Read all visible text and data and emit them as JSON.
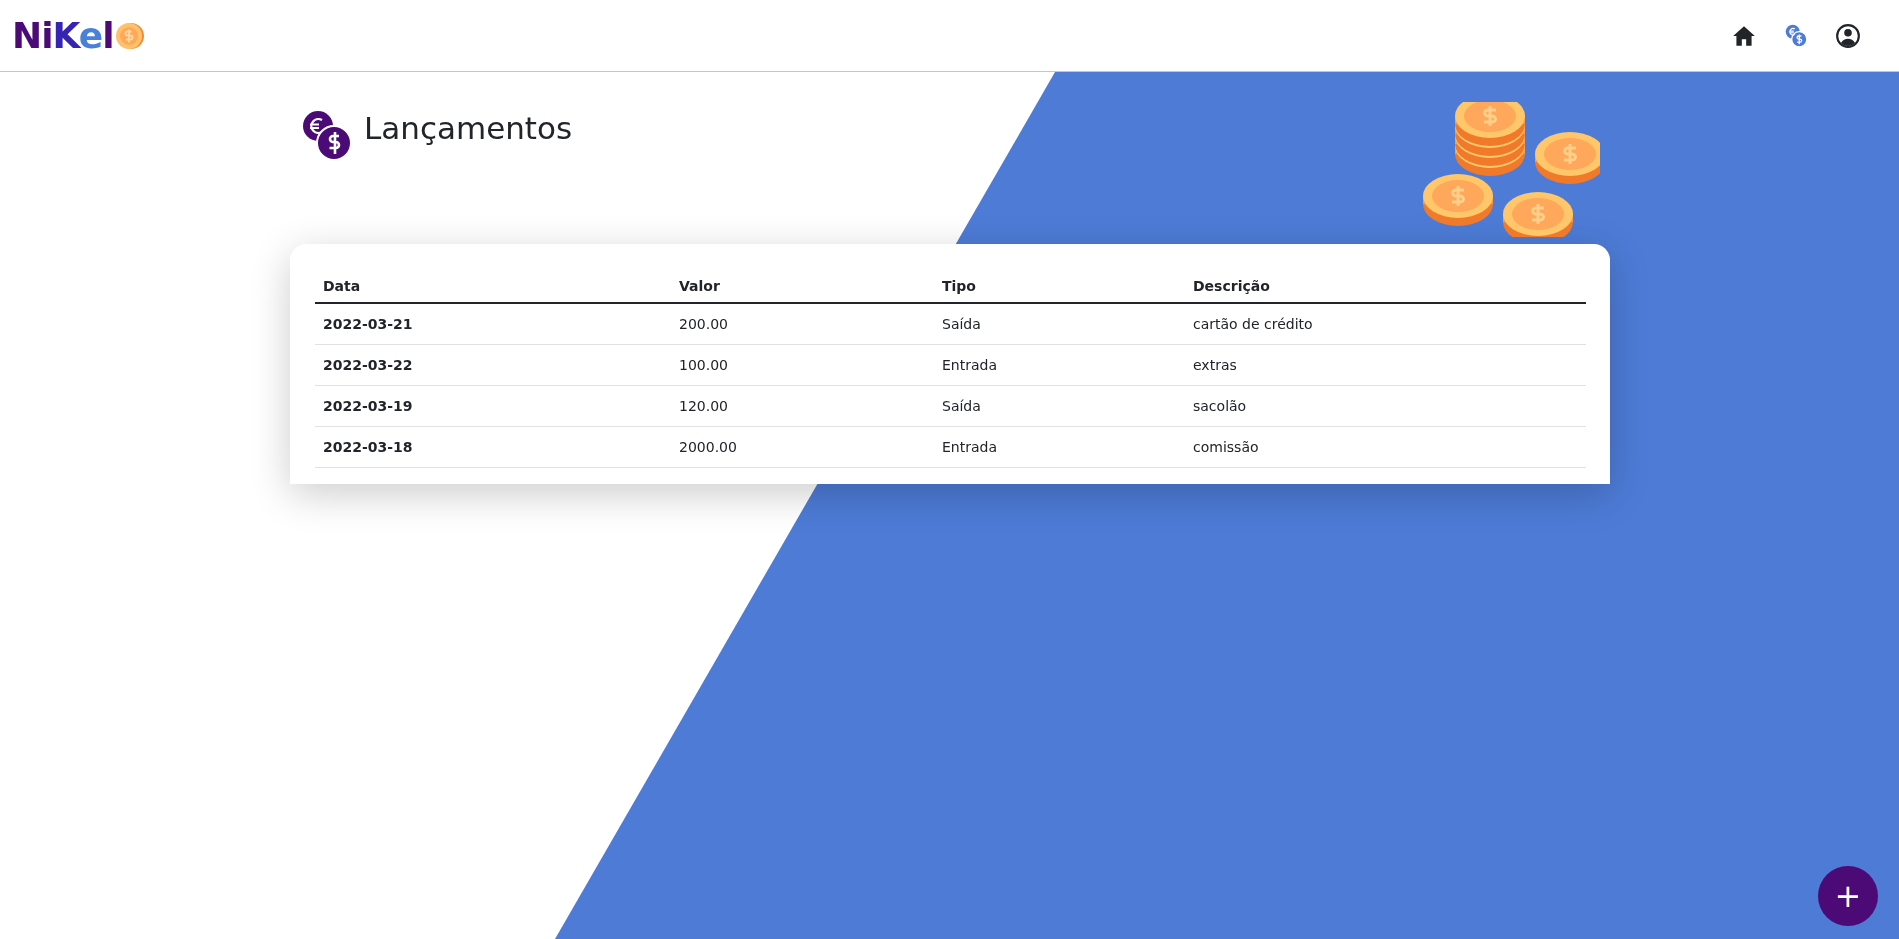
{
  "navbar": {
    "logo": [
      {
        "text": "Ni",
        "color": "#4b0a76"
      },
      {
        "text": "K",
        "color": "#3624b4"
      },
      {
        "text": "e",
        "color": "#4a80d8"
      },
      {
        "text": "l",
        "color": "#4b0a76"
      }
    ]
  },
  "page": {
    "title": "Lançamentos"
  },
  "table": {
    "columns": [
      "Data",
      "Valor",
      "Tipo",
      "Descrição"
    ],
    "rows": [
      [
        "2022-03-21",
        "200.00",
        "Saída",
        "cartão de crédito"
      ],
      [
        "2022-03-22",
        "100.00",
        "Entrada",
        "extras"
      ],
      [
        "2022-03-19",
        "120.00",
        "Saída",
        "sacolão"
      ],
      [
        "2022-03-18",
        "2000.00",
        "Entrada",
        "comissão"
      ]
    ]
  },
  "fab": {
    "label": "+"
  }
}
